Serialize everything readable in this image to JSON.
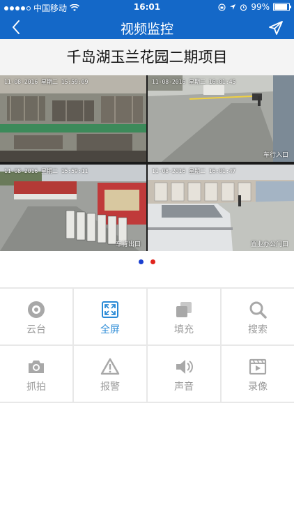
{
  "status_bar": {
    "carrier": "中国移动",
    "time": "16:01",
    "battery": "99%",
    "battery_level": 0.99
  },
  "nav": {
    "title": "视频监控",
    "back_icon": "chevron-left-icon",
    "share_icon": "share-arrow-icon"
  },
  "project": {
    "title": "千岛湖玉兰花园二期项目"
  },
  "cameras": [
    {
      "timestamp": "11-08-2016 星期二 15:59:09",
      "label": ""
    },
    {
      "timestamp": "11-08-2016 星期二 16:01:45",
      "label": "车行入口"
    },
    {
      "timestamp": "11-08-2016 星期二 15:59:11",
      "label": "车行出口"
    },
    {
      "timestamp": "11-08-2016 星期二 16:01:47",
      "label": "置业办公门口"
    }
  ],
  "pager": {
    "active_color": "#1a3fd0",
    "inactive_color": "#e0241c"
  },
  "controls": [
    {
      "label": "云台",
      "icon": "ptz-gear-icon"
    },
    {
      "label": "全屏",
      "icon": "fullscreen-icon"
    },
    {
      "label": "填充",
      "icon": "fill-icon"
    },
    {
      "label": "搜索",
      "icon": "search-icon"
    },
    {
      "label": "抓拍",
      "icon": "camera-icon"
    },
    {
      "label": "报警",
      "icon": "alarm-warning-icon"
    },
    {
      "label": "声音",
      "icon": "speaker-icon"
    },
    {
      "label": "录像",
      "icon": "record-video-icon"
    }
  ],
  "colors": {
    "header": "#1468c8",
    "control_active": "#2a8ad6",
    "control_inactive": "#9a9a9a"
  }
}
